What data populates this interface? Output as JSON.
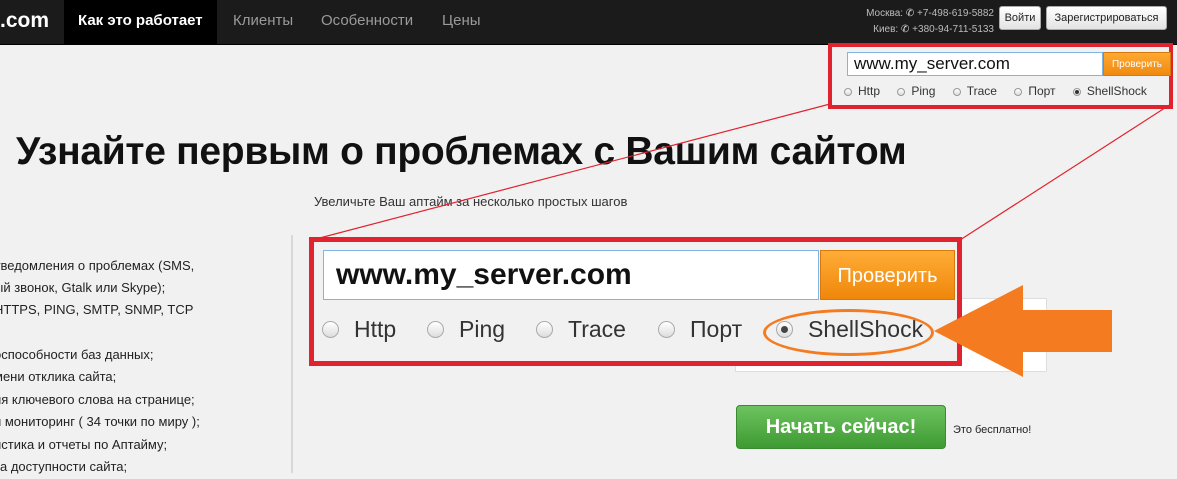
{
  "navbar": {
    "logo": ".com",
    "items": [
      {
        "label": "Как это работает",
        "active": true
      },
      {
        "label": "Клиенты"
      },
      {
        "label": "Особенности"
      },
      {
        "label": "Цены"
      }
    ],
    "contacts": [
      {
        "city": "Москва:",
        "phone": "+7-498-619-5882"
      },
      {
        "city": "Киев:",
        "phone": "+380-94-711-5133"
      }
    ],
    "login_label": "Войти",
    "register_label": "Зарегистрироваться"
  },
  "small_widget": {
    "url_value": "www.my_server.com",
    "check_label": "Проверить",
    "options": [
      "Http",
      "Ping",
      "Trace",
      "Порт",
      "ShellShock"
    ],
    "selected": "ShellShock"
  },
  "hero": {
    "title": "Узнайте первым о проблемах с Вашим сайтом",
    "subtitle": "Увеличьте Ваш аптайм за несколько простых шагов"
  },
  "features": [
    "уведомления о проблемах (SMS,",
    "ый звонок, Gtalk или Skype);",
    "HTTPS, PING, SMTP, SNMP, TCP",
    "",
    "оспособности баз данных;",
    "мени отклика сайта;",
    "ия ключевого слова на странице;",
    "й мониторинг ( 34 точки по миру );",
    "истика и отчеты по Аптайму;",
    "ка доступности сайта;"
  ],
  "big_widget": {
    "url_value": "www.my_server.com",
    "check_label": "Проверить",
    "options": [
      "Http",
      "Ping",
      "Trace",
      "Порт",
      "ShellShock"
    ],
    "selected": "ShellShock"
  },
  "cta": {
    "label": "Начать сейчас!",
    "note": "Это бесплатно!"
  },
  "colors": {
    "highlight_red": "#e0232f",
    "arrow_orange": "#f47b20",
    "check_button_orange": "#f5951f",
    "cta_green": "#4eab3f",
    "navbar": "#1b1b1b"
  }
}
